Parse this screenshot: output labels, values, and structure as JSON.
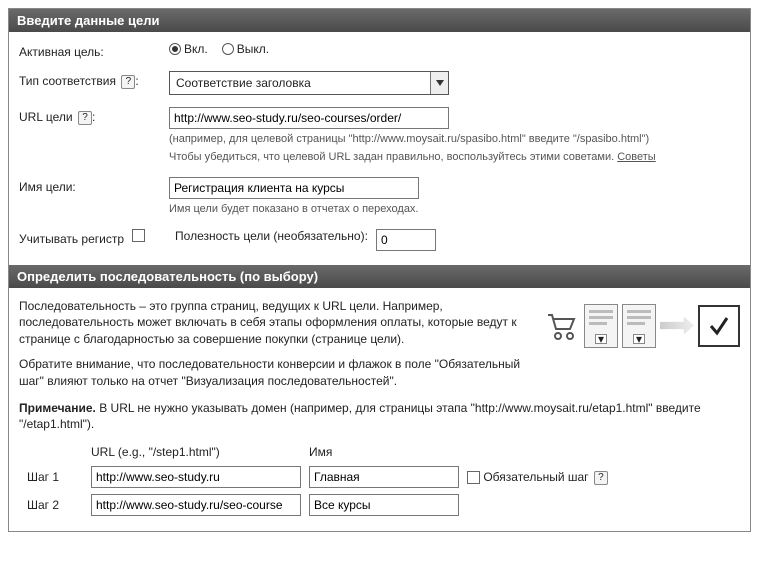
{
  "section1": {
    "title": "Введите данные цели",
    "active": {
      "label": "Активная цель:",
      "on": "Вкл.",
      "off": "Выкл."
    },
    "match_type": {
      "label": "Тип соответствия",
      "value": "Соответствие заголовка"
    },
    "goal_url": {
      "label": "URL цели",
      "value": "http://www.seo-study.ru/seo-courses/order/",
      "hint1": "(например, для целевой страницы \"http://www.moysait.ru/spasibo.html\" введите \"/spasibo.html\")",
      "hint2_pre": "Чтобы убедиться, что целевой URL задан правильно, воспользуйтесь этими советами. ",
      "hint2_link": "Советы"
    },
    "goal_name": {
      "label": "Имя цели:",
      "value": "Регистрация клиента на курсы",
      "hint": "Имя цели будет показано в отчетах о переходах."
    },
    "case_sensitive": {
      "label": "Учитывать регистр"
    },
    "goal_value": {
      "label": "Полезность цели (необязательно):",
      "value": "0"
    }
  },
  "section2": {
    "title": "Определить последовательность (по выбору)",
    "desc1": "Последовательность – это группа страниц, ведущих к URL цели. Например, последовательность может включать в себя этапы оформления оплаты, которые ведут к странице с благодарностью за совершение покупки (странице цели).",
    "desc2": "Обратите внимание, что последовательности конверсии и флажок в поле \"Обязательный шаг\" влияют только на отчет \"Визуализация последовательностей\".",
    "note_label": "Примечание.",
    "note_text": " В URL не нужно указывать домен (например, для страницы этапа \"http://www.moysait.ru/etap1.html\" введите \"/etap1.html\").",
    "columns": {
      "url": "URL (e.g., \"/step1.html\")",
      "name": "Имя"
    },
    "required_step": "Обязательный шаг",
    "steps": [
      {
        "label": "Шаг 1",
        "url": "http://www.seo-study.ru",
        "name": "Главная"
      },
      {
        "label": "Шаг 2",
        "url": "http://www.seo-study.ru/seo-course",
        "name": "Все курсы"
      }
    ]
  }
}
